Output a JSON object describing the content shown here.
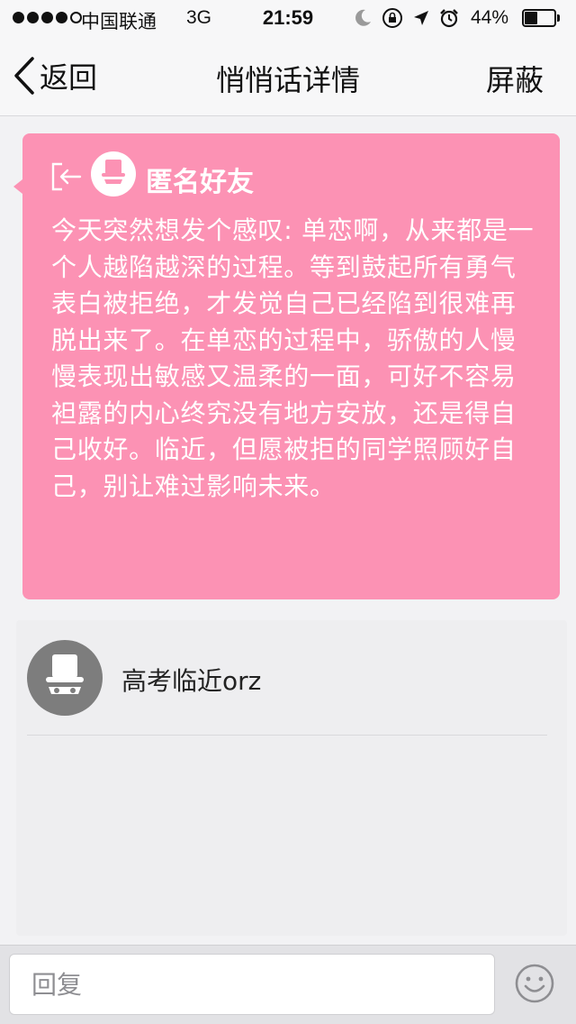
{
  "status_bar": {
    "carrier": "中国联通",
    "network": "3G",
    "time": "21:59",
    "battery_percent": "44%",
    "battery_level": 0.44,
    "signal_bars_filled": 4,
    "signal_bars_total": 5
  },
  "nav": {
    "back_label": "返回",
    "title": "悄悄话详情",
    "block_label": "屏蔽"
  },
  "message": {
    "sender": "匿名好友",
    "text": "今天突然想发个感叹: 单恋啊，从来都是一个人越陷越深的过程。等到鼓起所有勇气表白被拒绝，才发觉自己已经陷到很难再脱出来了。在单恋的过程中，骄傲的人慢慢表现出敏感又温柔的一面，可好不容易袒露的内心终究没有地方安放，还是得自己收好。临近，但愿被拒的同学照顾好自己，别让难过影响未来。",
    "card_color": "#fc92b4"
  },
  "comments": [
    {
      "text": "高考临近orz"
    }
  ],
  "reply": {
    "placeholder": "回复"
  },
  "icons": {
    "back": "chevron-left-icon",
    "exit": "exit-arrow-icon",
    "anonymous_avatar": "top-hat-mask-avatar-icon",
    "emoji": "smiley-face-icon",
    "moon": "moon-icon",
    "rotation_lock": "rotation-lock-icon",
    "location": "location-arrow-icon",
    "alarm": "alarm-clock-icon"
  }
}
